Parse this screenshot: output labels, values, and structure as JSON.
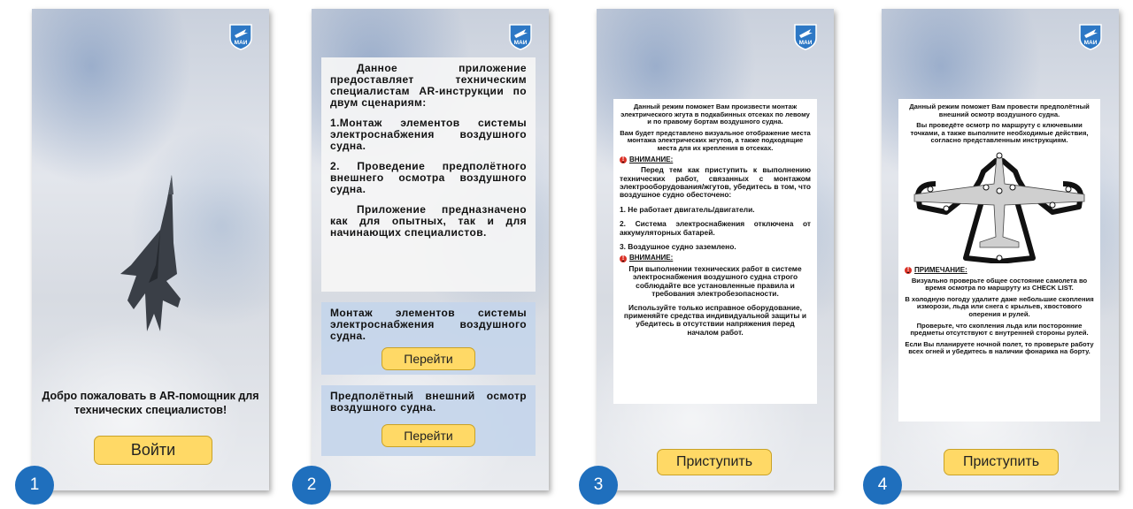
{
  "screens": {
    "s1": {
      "number": "1",
      "welcome": "Добро пожаловать в AR-помощник для технических специалистов!",
      "login_button": "Войти"
    },
    "s2": {
      "number": "2",
      "intro_p1": "Данное приложение предоставляет техническим специалистам AR-инструкции по двум сценариям:",
      "intro_p2": "1.Монтаж элементов системы электроснабжения воздушного судна.",
      "intro_p3": "2. Проведение предполётного внешнего осмотра воздушного судна.",
      "intro_p4": "Приложение предназначено как для опытных, так и для начинающих специалистов.",
      "card1_title": "Монтаж элементов системы электроснабжения воздушного судна.",
      "card1_button": "Перейти",
      "card2_title": "Предполётный внешний осмотр воздушного судна.",
      "card2_button": "Перейти"
    },
    "s3": {
      "number": "3",
      "p1": "Данный режим поможет Вам произвести монтаж электрического жгута в подкабинных отсеках по левому и по правому бортам воздушного судна.",
      "p2": "Вам будет представлено визуальное отображение места монтажа электрических жгутов, а также подходящие места для их крепления в отсеках.",
      "warning1_label": "ВНИМАНИЕ:",
      "w1_text": "Перед тем как приступить к выполнению технических работ, связанных с монтажом электрооборудования/жгутов, убедитесь в том, что воздушное судно обесточено:",
      "item1": "1. Не работает двигатель/двигатели.",
      "item2": "2. Система электроснабжения отключена от аккумуляторных батарей.",
      "item3": "3. Воздушное судно заземлено.",
      "warning2_label": "ВНИМАНИЕ:",
      "w2_text": "При выполнении технических работ в системе электроснабжения воздушного судна строго соблюдайте все установленные правила и требования электробезопасности.",
      "w2_text2": "Используйте только исправное оборудование, применяйте средства индивидуальной защиты и убедитесь в отсутствии напряжения перед началом работ.",
      "start_button": "Приступить"
    },
    "s4": {
      "number": "4",
      "p1": "Данный режим поможет Вам провести предполётный внешний осмотр воздушного судна.",
      "p2": "Вы проведёте осмотр по маршруту с ключевыми точками, а также выполните необходимые действия, согласно представленным инструкциям.",
      "note_label": "ПРИМЕЧАНИЕ:",
      "n1": "Визуально проверьте общее состояние самолета во время осмотра по маршруту из CHECK LIST.",
      "n2": "В холодную погоду удалите даже небольшие скопления изморози, льда или снега с крыльев, хвостового оперения и рулей.",
      "n3": "Проверьте, что скопления льда или посторонние предметы отсутствуют с внутренней стороны рулей.",
      "n4": "Если Вы планируете ночной полет, то проверьте работу всех огней и убедитесь в наличии фонарика на борту.",
      "start_button": "Приступить"
    }
  },
  "logo_text": "МАИ",
  "colors": {
    "button": "#ffd966",
    "badge": "#1f6fbd",
    "card": "#c4d5ea",
    "warning": "#d93025"
  }
}
